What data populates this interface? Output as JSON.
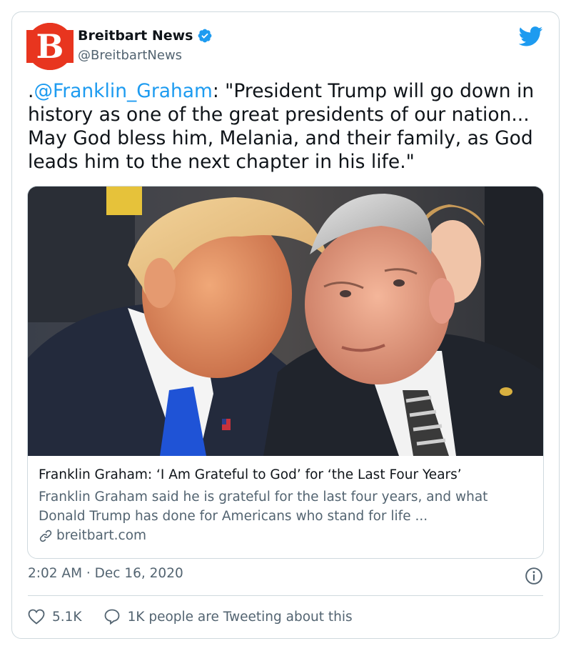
{
  "author": {
    "name": "Breitbart News",
    "handle": "@BreitbartNews",
    "verified": true,
    "avatar_letter": "B",
    "avatar_color": "#e8351f"
  },
  "tweet": {
    "prefix": ".",
    "mention": "@Franklin_Graham",
    "text": ": \"President Trump will go down in history as one of the great presidents of our nation... May God bless him, Melania, and their family, as God leads him to the next chapter in his life.\""
  },
  "link_card": {
    "image_icon": "photo-two-men-talking",
    "title": "Franklin Graham: ‘I Am Grateful to God’ for ‘the Last Four Years’",
    "description": "Franklin Graham said he is grateful for the last four years, and what Donald Trump has done for Americans who stand for life ...",
    "domain": "breitbart.com",
    "domain_icon": "link-icon"
  },
  "timestamp": "2:02 AM · Dec 16, 2020",
  "actions": {
    "likes": "5.1K",
    "like_icon": "heart-icon",
    "conversation": "1K people are Tweeting about this",
    "conversation_icon": "speech-bubble-icon"
  },
  "colors": {
    "accent": "#1d9bf0",
    "secondary_text": "#536471",
    "border": "#cfd9de"
  }
}
